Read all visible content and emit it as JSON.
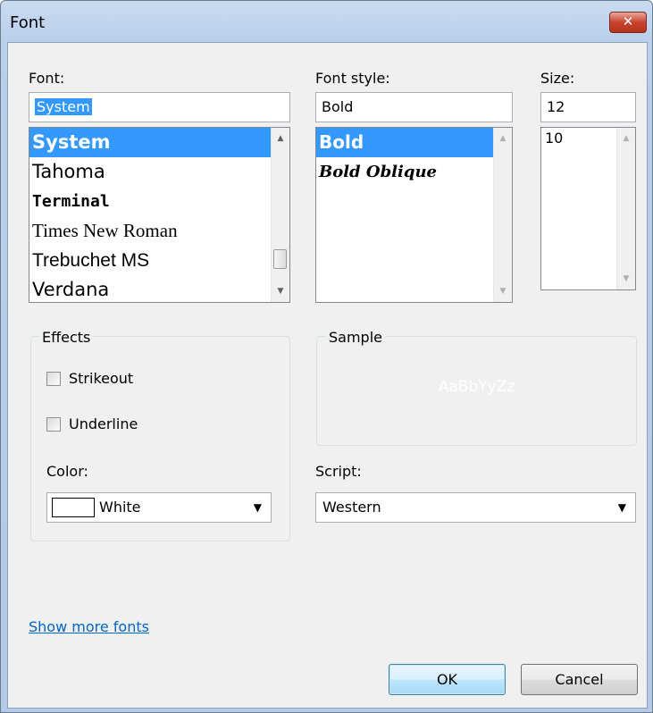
{
  "window": {
    "title": "Font",
    "close_glyph": "✕"
  },
  "font": {
    "label": "Font:",
    "value": "System",
    "items": [
      "System",
      "Tahoma",
      "Terminal",
      "Times New Roman",
      "Trebuchet MS",
      "Verdana"
    ],
    "selected": "System"
  },
  "font_style": {
    "label": "Font style:",
    "value": "Bold",
    "items": [
      "Bold",
      "Bold Oblique"
    ],
    "selected": "Bold"
  },
  "size": {
    "label": "Size:",
    "value": "12",
    "items": [
      "10"
    ]
  },
  "effects": {
    "title": "Effects",
    "strikeout_label": "Strikeout",
    "strikeout_checked": false,
    "underline_label": "Underline",
    "underline_checked": false,
    "color_label": "Color:",
    "color_value": "White",
    "color_swatch": "#ffffff"
  },
  "sample": {
    "title": "Sample",
    "text": "AaBbYyZz",
    "text_color": "#ffffff"
  },
  "script": {
    "label": "Script:",
    "value": "Western"
  },
  "show_more_fonts": "Show more fonts",
  "buttons": {
    "ok": "OK",
    "cancel": "Cancel"
  }
}
